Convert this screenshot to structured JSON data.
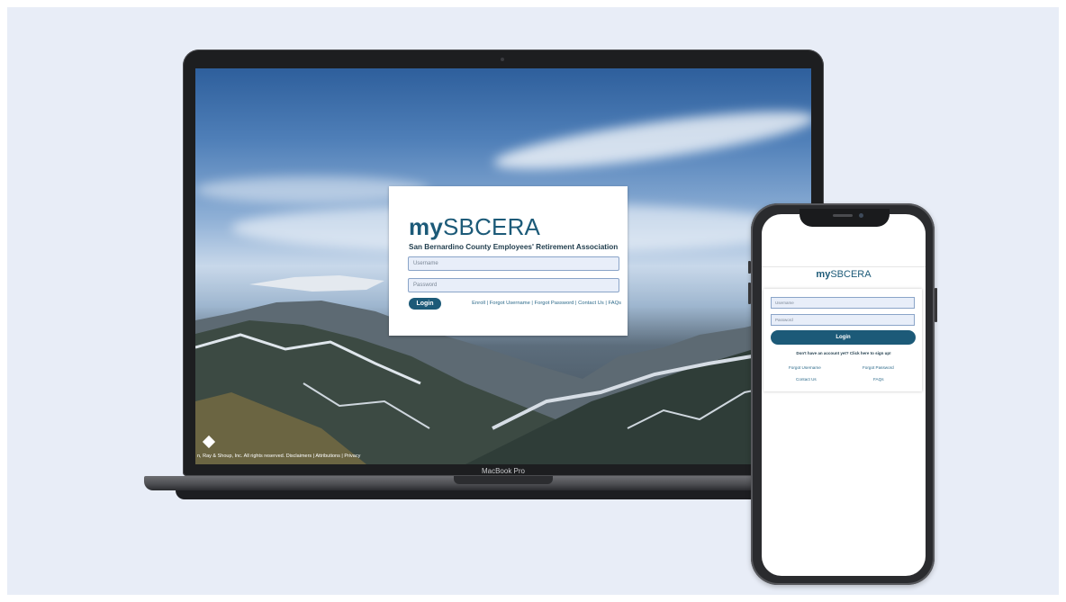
{
  "laptop": {
    "model_label": "MacBook Pro",
    "site": {
      "brand_bold": "my",
      "brand_rest": "SBCERA",
      "subtitle": "San Bernardino County Employees' Retirement Association",
      "username_placeholder": "Username",
      "password_placeholder": "Password",
      "login_label": "Login",
      "links": "Enroll | Forgot Username | Forgot Password | Contact Us | FAQs",
      "footer": "n, Ray & Shoup, Inc. All rights reserved.   Disclaimers | Attributions | Privacy"
    }
  },
  "phone": {
    "brand_bold": "my",
    "brand_rest": "SBCERA",
    "username_placeholder": "Username",
    "password_placeholder": "Password",
    "login_label": "Login",
    "signup_text": "Don't have an account yet? Click here to sign up!",
    "links": {
      "forgot_username": "Forgot Username",
      "forgot_password": "Forgot Password",
      "contact_us": "Contact Us",
      "faqs": "FAQs"
    }
  },
  "colors": {
    "brand": "#1c5a78",
    "stage_background": "#e8edf7"
  }
}
